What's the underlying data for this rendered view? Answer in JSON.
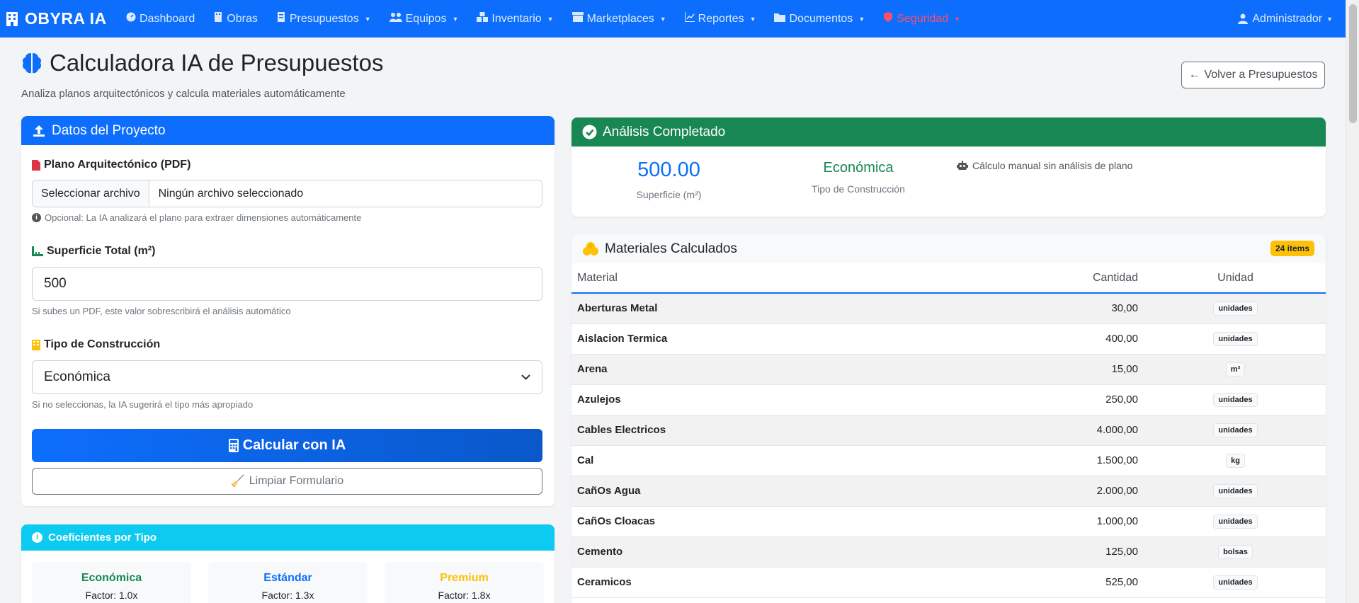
{
  "navbar": {
    "brand": "OBYRA IA",
    "items": [
      {
        "label": "Dashboard",
        "icon": "gauge-icon",
        "dropdown": false
      },
      {
        "label": "Obras",
        "icon": "building-icon",
        "dropdown": false
      },
      {
        "label": "Presupuestos",
        "icon": "document-icon",
        "dropdown": true
      },
      {
        "label": "Equipos",
        "icon": "users-icon",
        "dropdown": true
      },
      {
        "label": "Inventario",
        "icon": "boxes-icon",
        "dropdown": true
      },
      {
        "label": "Marketplaces",
        "icon": "store-icon",
        "dropdown": true
      },
      {
        "label": "Reportes",
        "icon": "chart-icon",
        "dropdown": true
      },
      {
        "label": "Documentos",
        "icon": "folder-icon",
        "dropdown": true
      },
      {
        "label": "Seguridad",
        "icon": "shield-icon",
        "dropdown": true
      }
    ],
    "user": "Administrador"
  },
  "header": {
    "title": "Calculadora IA de Presupuestos",
    "subtitle": "Analiza planos arquitectónicos y calcula materiales automáticamente",
    "back_button": "Volver a Presupuestos"
  },
  "form": {
    "title": "Datos del Proyecto",
    "plan_label": "Plano Arquitectónico (PDF)",
    "file_button": "Seleccionar archivo",
    "file_status": "Ningún archivo seleccionado",
    "plan_help": "Opcional: La IA analizará el plano para extraer dimensiones automáticamente",
    "surface_label": "Superficie Total (m²)",
    "surface_value": "500",
    "surface_help": "Si subes un PDF, este valor sobrescribirá el análisis automático",
    "type_label": "Tipo de Construcción",
    "type_value": "Económica",
    "type_help": "Si no seleccionas, la IA sugerirá el tipo más apropiado",
    "calc_button": "Calcular con IA",
    "clear_button": "Limpiar Formulario"
  },
  "coefficients": {
    "title": "Coeficientes por Tipo",
    "items": [
      {
        "name": "Económica",
        "factor": "Factor: 1.0x",
        "color": "#198754"
      },
      {
        "name": "Estándar",
        "factor": "Factor: 1.3x",
        "color": "#0d6efd"
      },
      {
        "name": "Premium",
        "factor": "Factor: 1.8x",
        "color": "#ffc107"
      }
    ]
  },
  "analysis": {
    "title": "Análisis Completado",
    "surface_value": "500.00",
    "surface_label": "Superficie (m²)",
    "type_value": "Económica",
    "type_label": "Tipo de Construcción",
    "note": "Cálculo manual sin análisis de plano"
  },
  "materials": {
    "title": "Materiales Calculados",
    "badge": "24 items",
    "columns": [
      "Material",
      "Cantidad",
      "Unidad"
    ],
    "rows": [
      {
        "material": "Aberturas Metal",
        "qty": "30,00",
        "unit": "unidades"
      },
      {
        "material": "Aislacion Termica",
        "qty": "400,00",
        "unit": "unidades"
      },
      {
        "material": "Arena",
        "qty": "15,00",
        "unit": "m³"
      },
      {
        "material": "Azulejos",
        "qty": "250,00",
        "unit": "unidades"
      },
      {
        "material": "Cables Electricos",
        "qty": "4.000,00",
        "unit": "unidades"
      },
      {
        "material": "Cal",
        "qty": "1.500,00",
        "unit": "kg"
      },
      {
        "material": "CañOs Agua",
        "qty": "2.000,00",
        "unit": "unidades"
      },
      {
        "material": "CañOs Cloacas",
        "qty": "1.000,00",
        "unit": "unidades"
      },
      {
        "material": "Cemento",
        "qty": "125,00",
        "unit": "bolsas"
      },
      {
        "material": "Ceramicos",
        "qty": "525,00",
        "unit": "unidades"
      }
    ]
  },
  "colors": {
    "primary": "#0d6efd",
    "success": "#198754",
    "info": "#0dcaf0",
    "warning": "#ffc107",
    "danger": "#ff4d6d"
  }
}
